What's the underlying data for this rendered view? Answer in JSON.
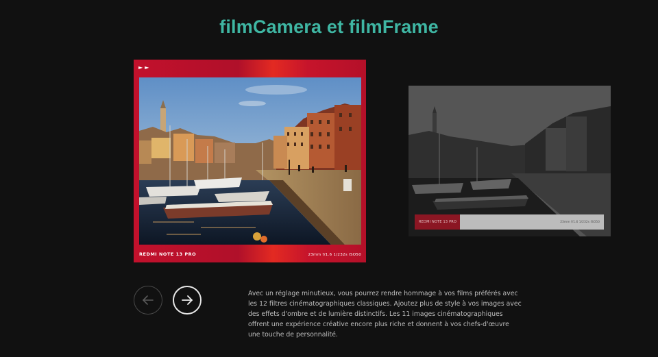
{
  "header": {
    "title": "filmCamera et filmFrame"
  },
  "main_card": {
    "top_marks": "►►",
    "brand": "REDMI NOTE 13 PRO",
    "params": "23mm  f/1.6  1/232s  ISO50"
  },
  "alt_card": {
    "brand": "REDMI NOTE 13 PRO",
    "params": "23mm f/1.6 1/232s ISO50"
  },
  "nav": {
    "prev_icon": "arrow-left-icon",
    "next_icon": "arrow-right-icon"
  },
  "description": "Avec un réglage minutieux, vous pourrez rendre hommage à vos films préférés avec les 12 filtres cinématographiques classiques. Ajoutez plus de style à vos images avec des effets d'ombre et de lumière distinctifs. Les 11 images cinématographiques offrent une expérience créative encore plus riche et donnent à vos chefs-d'œuvre une touche de personnalité.",
  "colors": {
    "title": "#3fb6a3",
    "frame_red": "#c2112c",
    "background": "#111111"
  }
}
